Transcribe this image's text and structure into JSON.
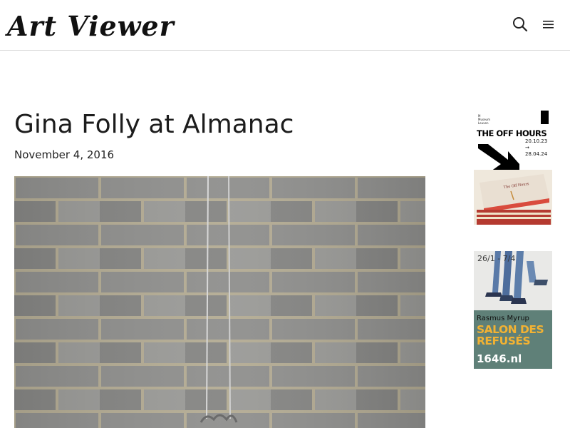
{
  "site": {
    "logo_text": "Art Viewer"
  },
  "header": {
    "search_icon": "search-icon",
    "menu_icon": "hamburger-menu-icon"
  },
  "article": {
    "title": "Gina Folly at Almanac",
    "date": "November 4, 2016",
    "image": {
      "subject": "grey brick wall with hanging wires",
      "wall_color": "#8f8f8d",
      "mortar_color": "#b3ab93"
    }
  },
  "sidebar": {
    "ads": [
      {
        "brand_lines": [
          "M",
          "Museum",
          "Leuven"
        ],
        "headline": "THE OFF HOURS",
        "dates": [
          "20.10.23",
          "→ 28.04.24"
        ],
        "book_title": "The Off Hours",
        "accent": "#000000"
      },
      {
        "dates": "26/1 - 7/4",
        "artist": "Rasmus Myrup",
        "title_lines": [
          "SALON DES",
          "REFUSÉS"
        ],
        "url": "1646.nl",
        "bg_color": "#5f8078",
        "title_color": "#f2b233"
      }
    ]
  }
}
